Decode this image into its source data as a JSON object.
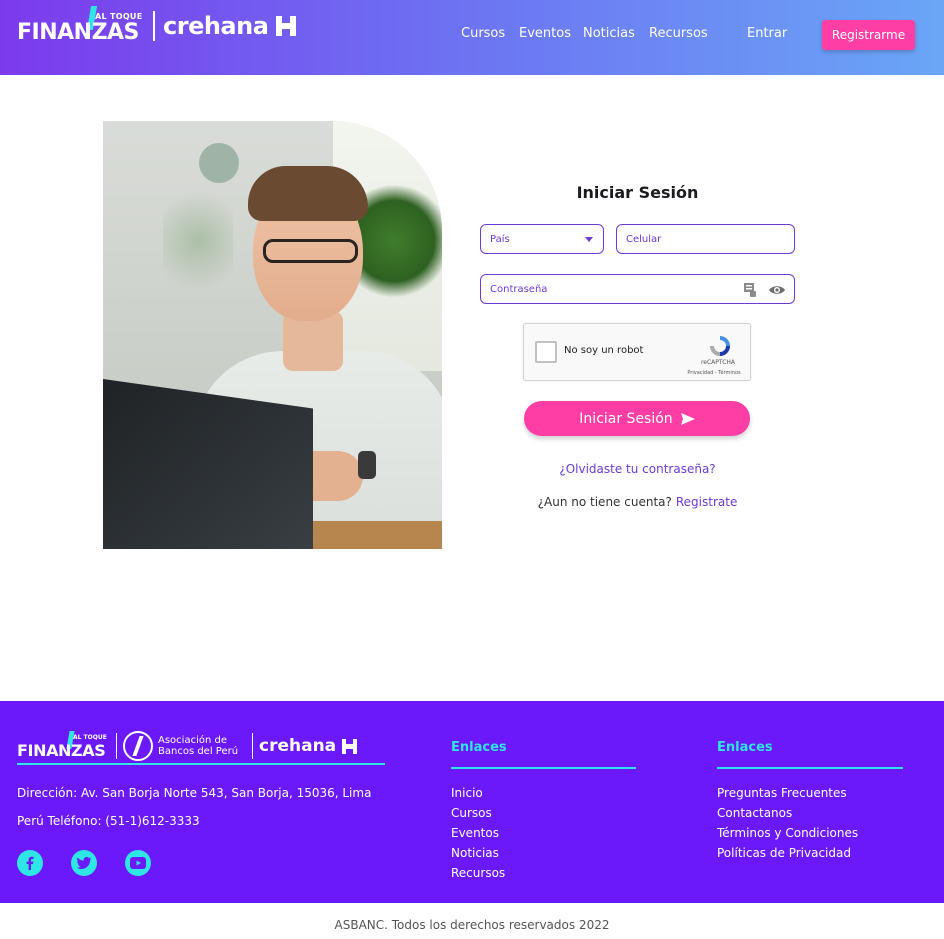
{
  "header": {
    "logo_finanzas_top": "AL TOQUE",
    "logo_finanzas_word": "FINANZAS",
    "logo_crehana": "crehana",
    "nav": [
      {
        "label": "Cursos"
      },
      {
        "label": "Eventos"
      },
      {
        "label": "Noticias"
      },
      {
        "label": "Recursos"
      },
      {
        "label": "Entrar"
      }
    ],
    "register_label": "Registrarme"
  },
  "login": {
    "title": "Iniciar Sesión",
    "pais_placeholder": "País",
    "celular_placeholder": "Celular",
    "password_placeholder": "Contraseña",
    "captcha_label": "No soy un robot",
    "captcha_brand": "reCAPTCHA",
    "captcha_links": "Privacidad - Términos",
    "submit_label": "Iniciar Sesión",
    "forgot_label": "¿Olvidaste tu contraseña?",
    "no_account_text": "¿Aun no tiene cuenta?",
    "signup_label": "Registrate"
  },
  "footer": {
    "logo_asociacion": "Asociación de Bancos del Perú",
    "address": "Dirección: Av. San Borja Norte 543, San Borja, 15036, Lima",
    "phone": "Perú Teléfono: (51-1)612-3333",
    "columns": [
      {
        "title": "Enlaces",
        "links": [
          "Inicio",
          "Cursos",
          "Eventos",
          "Noticias",
          "Recursos"
        ]
      },
      {
        "title": "Enlaces",
        "links": [
          "Preguntas Frecuentes",
          "Contactanos",
          "Términos y Condiciones",
          "Políticas de Privacidad"
        ]
      }
    ],
    "social": [
      "facebook-icon",
      "twitter-icon",
      "youtube-icon"
    ],
    "copyright": "ASBANC. Todos los derechos reservados 2022"
  },
  "colors": {
    "accent_pink": "#ff3ea5",
    "purple": "#6b18fb",
    "cyan": "#2ee6e6",
    "field_border": "#6e3bd6"
  }
}
